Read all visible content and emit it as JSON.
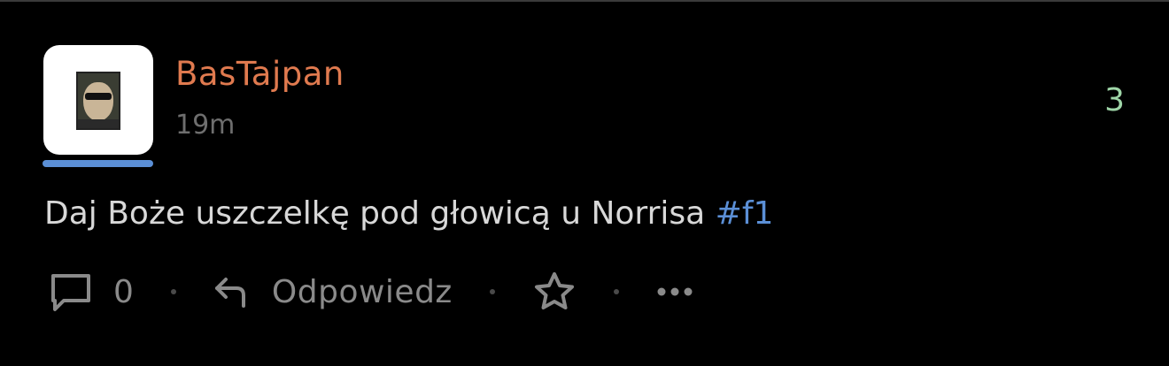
{
  "post": {
    "author": "BasTajpan",
    "time": "19m",
    "score": "3",
    "text": "Daj Boże uszczelkę pod głowicą u Norrisa ",
    "hashtag": "#f1"
  },
  "actions": {
    "comments_count": "0",
    "reply_label": "Odpowiedz"
  },
  "colors": {
    "author": "#e07a4f",
    "accent": "#5b8fd6",
    "score": "#9fd6a8",
    "muted": "#8a8a8a",
    "background": "#000000"
  },
  "icons": [
    "comment-icon",
    "reply-icon",
    "star-icon",
    "more-icon"
  ]
}
